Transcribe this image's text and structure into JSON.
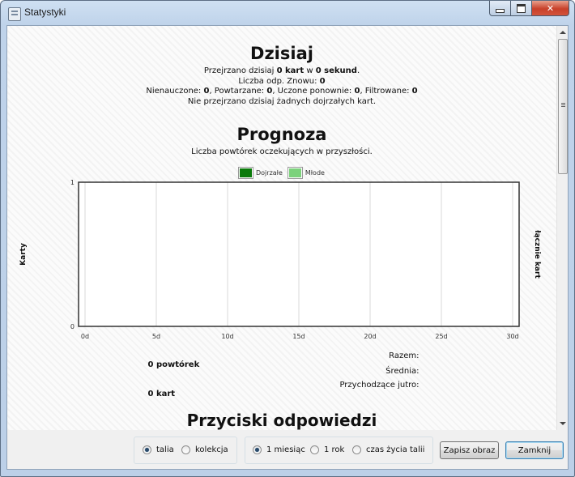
{
  "window": {
    "title": "Statystyki"
  },
  "today": {
    "title": "Dzisiaj",
    "reviewed_pre": "Przejrzano dzisiaj ",
    "reviewed_cards": "0 kart",
    "reviewed_mid": " w ",
    "reviewed_secs": "0 sekund",
    "reviewed_post": ".",
    "again_label": "Liczba odp. Znowu: ",
    "again_value": "0",
    "learn_label": "Nienauczone: ",
    "learn_value": "0",
    "review_label": ", Powtarzane: ",
    "review_value": "0",
    "relearn_label": ", Uczone ponownie: ",
    "relearn_value": "0",
    "filtered_label": ", Filtrowane: ",
    "filtered_value": "0",
    "mature_note": "Nie przejrzano dzisiaj żadnych dojrzałych kart."
  },
  "forecast": {
    "title": "Prognoza",
    "subtitle": "Liczba powtórek oczekujących w przyszłości.",
    "legend": [
      {
        "name": "Dojrzałe",
        "color": "#0a7a0a"
      },
      {
        "name": "Młode",
        "color": "#7cd27c"
      }
    ],
    "total_label": "Razem:",
    "total_value": "0 powtórek",
    "avg_label": "Średnia:",
    "avg_value": "",
    "tomorrow_label": "Przychodzące jutro:",
    "tomorrow_value": "0 kart"
  },
  "chart_data": {
    "type": "bar",
    "x": [
      "0d",
      "5d",
      "10d",
      "15d",
      "20d",
      "25d",
      "30d"
    ],
    "xlim": [
      0,
      30
    ],
    "ylim": [
      0,
      1
    ],
    "yticks": [
      "0",
      "1"
    ],
    "ylabel": "Karty",
    "y2label": "łącznie kart",
    "series": [
      {
        "name": "Dojrzałe",
        "values": []
      },
      {
        "name": "Młode",
        "values": []
      }
    ],
    "grid": true
  },
  "answers": {
    "title": "Przyciski odpowiedzi"
  },
  "controls": {
    "scope": [
      {
        "label": "talia",
        "checked": true
      },
      {
        "label": "kolekcja",
        "checked": false
      }
    ],
    "period": [
      {
        "label": "1 miesiąc",
        "checked": true
      },
      {
        "label": "1 rok",
        "checked": false
      },
      {
        "label": "czas życia talii",
        "checked": false
      }
    ],
    "save_label": "Zapisz obraz",
    "close_label": "Zamknij"
  }
}
